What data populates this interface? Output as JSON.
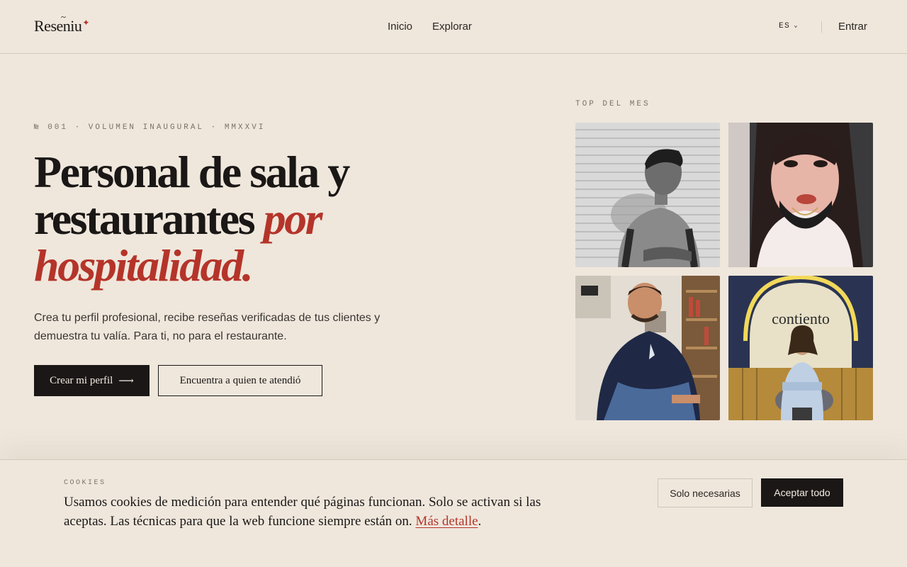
{
  "header": {
    "logo_text": "Reseniu",
    "nav": [
      {
        "label": "Inicio"
      },
      {
        "label": "Explorar"
      }
    ],
    "language": "ES",
    "login_label": "Entrar"
  },
  "hero": {
    "kicker": "№ 001 · VOLUMEN INAUGURAL · MMXXVI",
    "headline_part1": "Personal de sala y restaurantes ",
    "headline_accent": "por hospitalidad.",
    "lead": "Crea tu perfil profesional, recibe reseñas verificadas de tus clientes y demuestra tu valía. Para ti, no para el restaurante.",
    "primary_button": "Crear mi perfil",
    "primary_arrow": "⟶",
    "secondary_button": "Encuentra a quien te atendió"
  },
  "top": {
    "label": "TOP DEL MES",
    "photo_sign_text": "contiento"
  },
  "cookie": {
    "label": "COOKIES",
    "text": "Usamos cookies de medición para entender qué páginas funcionan. Solo se activan si las aceptas. Las técnicas para que la web funcione siempre están on. ",
    "link": "Más detalle",
    "period": ".",
    "necessary_button": "Solo necesarias",
    "accept_button": "Aceptar todo"
  },
  "colors": {
    "background": "#efe7dc",
    "accent": "#b5342a",
    "ink": "#1a1716"
  }
}
